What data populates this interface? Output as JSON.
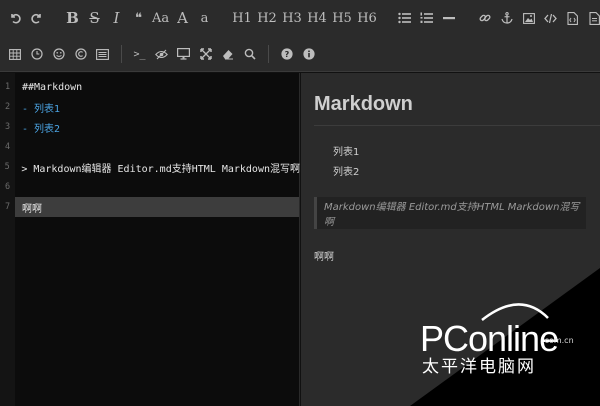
{
  "toolbar": {
    "row1": {
      "bold": "B",
      "strike": "S",
      "italic": "I",
      "quote": "❝",
      "case_upper": "Aa",
      "case_a": "A",
      "case_lower": "a",
      "h1": "H1",
      "h2": "H2",
      "h3": "H3",
      "h4": "H4",
      "h5": "H5",
      "h6": "H6"
    },
    "row2": {
      "code_sym": ">_"
    }
  },
  "editor": {
    "lines": [
      {
        "num": "1",
        "text": "##Markdown"
      },
      {
        "num": "2",
        "text": "- 列表1"
      },
      {
        "num": "3",
        "text": "- 列表2"
      },
      {
        "num": "4",
        "text": ""
      },
      {
        "num": "5",
        "text": "> Markdown编辑器 Editor.md支持HTML Markdown混写啊"
      },
      {
        "num": "6",
        "text": ""
      },
      {
        "num": "7",
        "text": "啊啊"
      }
    ]
  },
  "preview": {
    "heading": "Markdown",
    "list": [
      "列表1",
      "列表2"
    ],
    "blockquote": "Markdown编辑器 Editor.md支持HTML Markdown混写啊",
    "paragraph": "啊啊"
  },
  "watermark": {
    "brand": "PConline",
    "domain": ".com.cn",
    "cn": "太平洋电脑网"
  },
  "colors": {
    "toolbar_bg": "#2b2b2b",
    "editor_bg": "#0c0c0c",
    "preview_bg": "#2b2b2b",
    "list_blue": "#4ba3e2",
    "active_line": "#3d3d3d"
  }
}
